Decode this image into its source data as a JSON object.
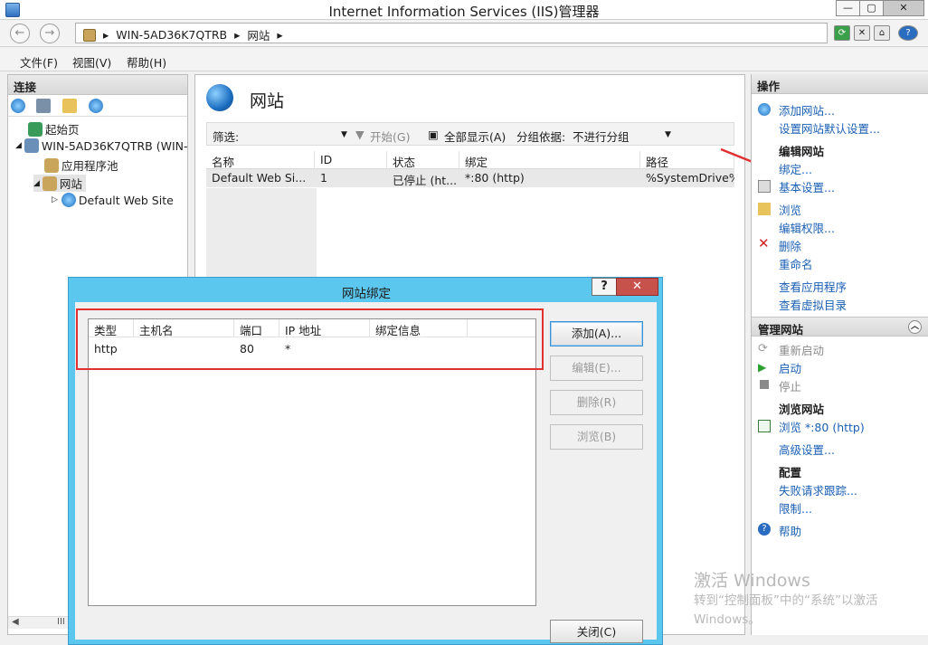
{
  "window": {
    "title": "Internet Information Services (IIS)管理器",
    "buttons": [
      "—",
      "▢",
      "✕"
    ]
  },
  "address": {
    "crumbs": [
      "WIN-5AD36K7QTRB",
      "网站"
    ]
  },
  "menu": {
    "file": "文件(F)",
    "view": "视图(V)",
    "help": "帮助(H)"
  },
  "connections": {
    "header": "连接",
    "tree": [
      {
        "label": "起始页"
      },
      {
        "label": "WIN-5AD36K7QTRB (WIN-"
      },
      {
        "label": "应用程序池"
      },
      {
        "label": "网站"
      },
      {
        "label": "Default Web Site"
      }
    ],
    "hscroll": "III"
  },
  "main": {
    "title": "网站",
    "filter_label": "筛选:",
    "start_label": "开始(G)",
    "show_all_label": "全部显示(A)",
    "group_by_label": "分组依据:",
    "group_by_value": "不进行分组",
    "columns": [
      "名称",
      "ID",
      "状态",
      "绑定",
      "路径"
    ],
    "row": {
      "name": "Default Web Si...",
      "id": "1",
      "status": "已停止 (ht...",
      "binding": "*:80 (http)",
      "path": "%SystemDrive%\\"
    }
  },
  "actions": {
    "header": "操作",
    "items": {
      "add_site": "添加网站...",
      "set_defaults": "设置网站默认设置...",
      "edit_site": "编辑网站",
      "bindings": "绑定...",
      "basic_settings": "基本设置...",
      "browse": "浏览",
      "edit_permissions": "编辑权限...",
      "delete": "删除",
      "rename": "重命名",
      "view_apps": "查看应用程序",
      "view_vdirs": "查看虚拟目录",
      "manage_site": "管理网站",
      "restart": "重新启动",
      "start": "启动",
      "stop": "停止",
      "browse_site": "浏览网站",
      "browse_http": "浏览 *:80 (http)",
      "advanced_settings": "高级设置...",
      "config": "配置",
      "failed_request_tracing": "失败请求跟踪...",
      "limits": "限制...",
      "help": "帮助"
    }
  },
  "watermark": {
    "line1": "激活 Windows",
    "line2": "转到“控制面板”中的“系统”以激活",
    "line3": "Windows。"
  },
  "dialog": {
    "title": "网站绑定",
    "help_btn": "?",
    "close_btn": "✕",
    "columns": [
      "类型",
      "主机名",
      "端口",
      "IP 地址",
      "绑定信息"
    ],
    "rows": [
      {
        "type": "http",
        "host": "",
        "port": "80",
        "ip": "*",
        "info": ""
      }
    ],
    "buttons": {
      "add": "添加(A)...",
      "edit": "编辑(E)...",
      "remove": "删除(R)",
      "browse": "浏览(B)",
      "close": "关闭(C)"
    }
  },
  "colors": {
    "dialog_frame": "#5bc6ee",
    "highlight": "#e03030",
    "link": "#1a5fb4"
  }
}
